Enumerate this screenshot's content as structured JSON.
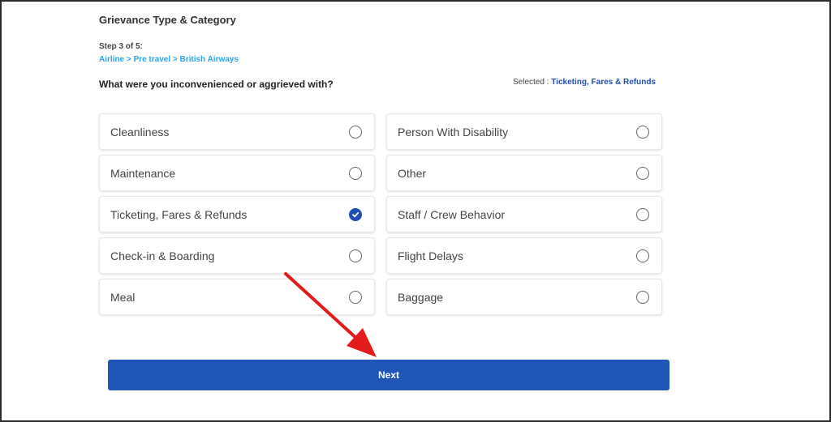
{
  "page": {
    "title": "Grievance Type & Category",
    "step": "Step 3 of 5:",
    "breadcrumb": "Airline > Pre travel > British Airways",
    "question": "What were you inconvenienced or aggrieved with?",
    "selected_label": "Selected : ",
    "selected_value": "Ticketing, Fares & Refunds"
  },
  "options_left": [
    {
      "label": "Cleanliness",
      "checked": false
    },
    {
      "label": "Maintenance",
      "checked": false
    },
    {
      "label": "Ticketing, Fares & Refunds",
      "checked": true
    },
    {
      "label": "Check-in & Boarding",
      "checked": false
    },
    {
      "label": "Meal",
      "checked": false
    }
  ],
  "options_right": [
    {
      "label": "Person With Disability",
      "checked": false
    },
    {
      "label": "Other",
      "checked": false
    },
    {
      "label": "Staff / Crew Behavior",
      "checked": false
    },
    {
      "label": "Flight Delays",
      "checked": false
    },
    {
      "label": "Baggage",
      "checked": false
    }
  ],
  "next_button": {
    "label": "Next"
  },
  "colors": {
    "accent": "#1f56b8",
    "link": "#2ea6e6",
    "annotation_arrow": "#e21b1b"
  }
}
